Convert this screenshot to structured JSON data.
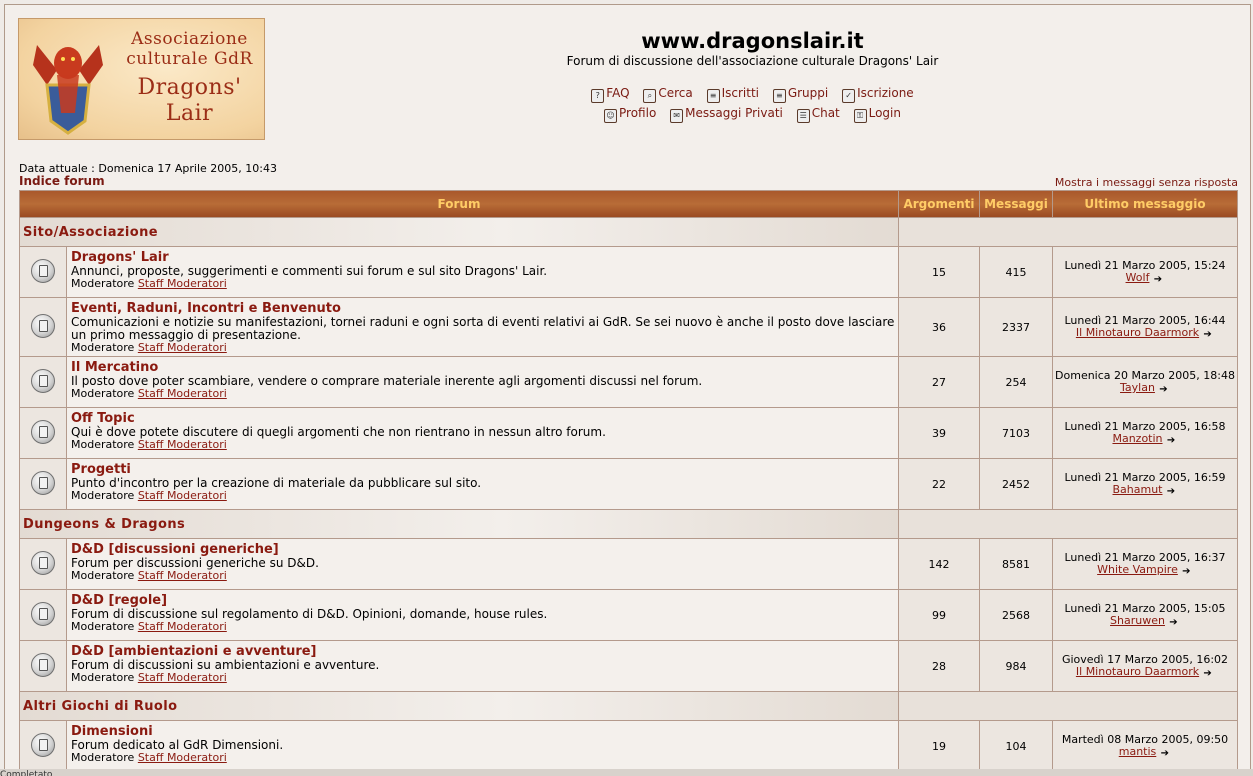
{
  "logo": {
    "line1": "Associazione\nculturale GdR",
    "line2": "Dragons'\nLair",
    "badge": "DRAGONS LAIR"
  },
  "header": {
    "title": "www.dragonslair.it",
    "description": "Forum di discussione dell'associazione culturale Dragons' Lair"
  },
  "nav": {
    "row1": [
      {
        "label": "FAQ",
        "icon": "help-icon"
      },
      {
        "label": "Cerca",
        "icon": "search-icon"
      },
      {
        "label": "Iscritti",
        "icon": "members-icon"
      },
      {
        "label": "Gruppi",
        "icon": "groups-icon"
      },
      {
        "label": "Iscrizione",
        "icon": "register-icon"
      }
    ],
    "row2": [
      {
        "label": "Profilo",
        "icon": "profile-icon"
      },
      {
        "label": "Messaggi Privati",
        "icon": "private-messages-icon"
      },
      {
        "label": "Chat",
        "icon": "chat-icon"
      },
      {
        "label": "Login",
        "icon": "login-icon"
      }
    ]
  },
  "current_date": "Data attuale : Domenica 17 Aprile 2005, 10:43",
  "index_link": "Indice forum",
  "unanswered_link": "Mostra i messaggi senza risposta",
  "table_headers": {
    "forum": "Forum",
    "topics": "Argomenti",
    "posts": "Messaggi",
    "last_post": "Ultimo messaggio"
  },
  "moderator_label": "Moderatore",
  "moderator_name": "Staff Moderatori",
  "categories": [
    {
      "name": "Sito/Associazione",
      "forums": [
        {
          "name": "Dragons' Lair",
          "desc": "Annunci, proposte, suggerimenti e commenti sui forum e sul sito Dragons' Lair.",
          "topics": "15",
          "posts": "415",
          "last_date": "Lunedì 21 Marzo 2005, 15:24",
          "last_user": "Wolf"
        },
        {
          "name": "Eventi, Raduni, Incontri e Benvenuto",
          "desc": "Comunicazioni e notizie su manifestazioni, tornei raduni e ogni sorta di eventi relativi ai GdR. Se sei nuovo è anche il posto dove lasciare un primo messaggio di presentazione.",
          "topics": "36",
          "posts": "2337",
          "last_date": "Lunedì 21 Marzo 2005, 16:44",
          "last_user": "Il Minotauro Daarmork"
        },
        {
          "name": "Il Mercatino",
          "desc": "Il posto dove poter scambiare, vendere o comprare materiale inerente agli argomenti discussi nel forum.",
          "topics": "27",
          "posts": "254",
          "last_date": "Domenica 20 Marzo 2005, 18:48",
          "last_user": "Taylan"
        },
        {
          "name": "Off Topic",
          "desc": "Qui è dove potete discutere di quegli argomenti che non rientrano in nessun altro forum.",
          "topics": "39",
          "posts": "7103",
          "last_date": "Lunedì 21 Marzo 2005, 16:58",
          "last_user": "Manzotin"
        },
        {
          "name": "Progetti",
          "desc": "Punto d'incontro per la creazione di materiale da pubblicare sul sito.",
          "topics": "22",
          "posts": "2452",
          "last_date": "Lunedì 21 Marzo 2005, 16:59",
          "last_user": "Bahamut"
        }
      ]
    },
    {
      "name": "Dungeons & Dragons",
      "forums": [
        {
          "name": "D&D [discussioni generiche]",
          "desc": "Forum per discussioni generiche su D&D.",
          "topics": "142",
          "posts": "8581",
          "last_date": "Lunedì 21 Marzo 2005, 16:37",
          "last_user": "White Vampire"
        },
        {
          "name": "D&D [regole]",
          "desc": "Forum di discussione sul regolamento di D&D. Opinioni, domande, house rules.",
          "topics": "99",
          "posts": "2568",
          "last_date": "Lunedì 21 Marzo 2005, 15:05",
          "last_user": "Sharuwen"
        },
        {
          "name": "D&D [ambientazioni e avventure]",
          "desc": "Forum di discussioni su ambientazioni e avventure.",
          "topics": "28",
          "posts": "984",
          "last_date": "Giovedì 17 Marzo 2005, 16:02",
          "last_user": "Il Minotauro Daarmork"
        }
      ]
    },
    {
      "name": "Altri Giochi di Ruolo",
      "forums": [
        {
          "name": "Dimensioni",
          "desc": "Forum dedicato al GdR Dimensioni.",
          "topics": "19",
          "posts": "104",
          "last_date": "Martedì 08 Marzo 2005, 09:50",
          "last_user": "mantis"
        }
      ]
    }
  ],
  "status_bar": "Completato"
}
